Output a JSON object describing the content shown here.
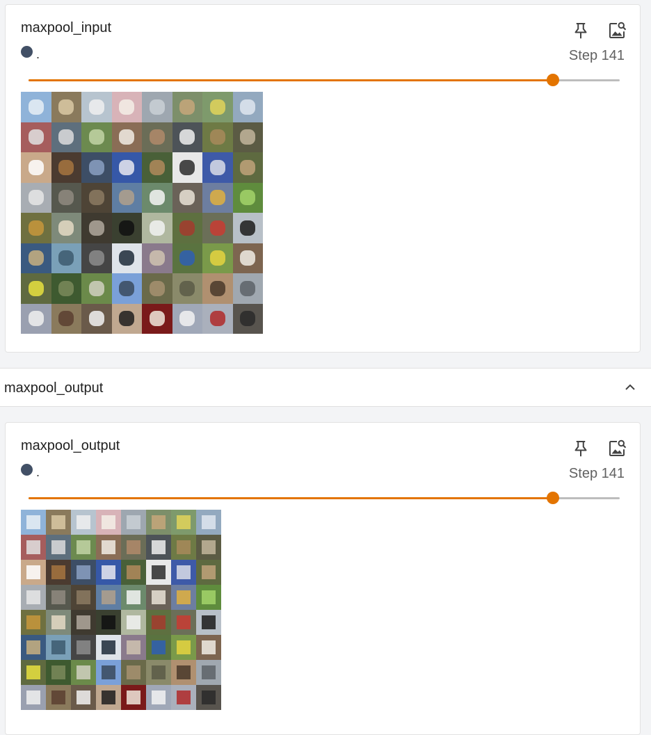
{
  "accent_color": "#e37400",
  "run_color": "#425066",
  "cards": [
    {
      "title": "maxpool_input",
      "run_name": ".",
      "step_label": "Step 141",
      "slider_value_fraction": 0.887,
      "pin_icon": "pin-icon",
      "image_icon": "image-search-icon"
    },
    {
      "title": "maxpool_output",
      "run_name": ".",
      "step_label": "Step 141",
      "slider_value_fraction": 0.887,
      "pin_icon": "pin-icon",
      "image_icon": "image-search-icon"
    }
  ],
  "section": {
    "title": "maxpool_output",
    "toggle_icon": "chevron-up-icon"
  },
  "image_grid": {
    "rows": 8,
    "cols": 8,
    "tiles": [
      [
        "#8fb3d9",
        "#e8eef5"
      ],
      [
        "#8a7a5c",
        "#d9c9a3"
      ],
      [
        "#b7c4cf",
        "#f0f0f0"
      ],
      [
        "#d8b3b8",
        "#f5efe6"
      ],
      [
        "#9ea7b0",
        "#c9d0d6"
      ],
      [
        "#7d8f6a",
        "#c6a77a"
      ],
      [
        "#7e9a6c",
        "#e0d35a"
      ],
      [
        "#93a9bf",
        "#dfe6ee"
      ],
      [
        "#a65d5d",
        "#e0e0e0"
      ],
      [
        "#5e6f7d",
        "#dcdcdc"
      ],
      [
        "#6c8a4f",
        "#c2d4a4"
      ],
      [
        "#8a6d56",
        "#f1ece4"
      ],
      [
        "#6b6d57",
        "#b08a6a"
      ],
      [
        "#4d5358",
        "#eeeeee"
      ],
      [
        "#6e7a45",
        "#a88a5a"
      ],
      [
        "#5b5b44",
        "#c2b59b"
      ],
      [
        "#c9a98a",
        "#ffffff"
      ],
      [
        "#4b3b30",
        "#a6763f"
      ],
      [
        "#3d4e66",
        "#8aa0c2"
      ],
      [
        "#3658a8",
        "#e8e8f0"
      ],
      [
        "#496038",
        "#b08a5c"
      ],
      [
        "#e8e8e8",
        "#2c2c2c"
      ],
      [
        "#3e5aa8",
        "#d9dde8"
      ],
      [
        "#5e6a40",
        "#c0a27a"
      ],
      [
        "#a8adb3",
        "#e6e6e6"
      ],
      [
        "#56584e",
        "#8f8a80"
      ],
      [
        "#4e4436",
        "#8c7a62"
      ],
      [
        "#5f7ea3",
        "#b0a08c"
      ],
      [
        "#6c8a6c",
        "#f5f5f5"
      ],
      [
        "#6a6258",
        "#e9e3d6"
      ],
      [
        "#6d7ea0",
        "#e0b040"
      ],
      [
        "#5f8c3d",
        "#a3d36a"
      ],
      [
        "#6f7040",
        "#c8963c"
      ],
      [
        "#7e8a7a",
        "#e4d9c4"
      ],
      [
        "#3f3a30",
        "#b0a89c"
      ],
      [
        "#3a4030",
        "#101010"
      ],
      [
        "#b0b8a0",
        "#f2f2f2"
      ],
      [
        "#5e7040",
        "#a33b2e"
      ],
      [
        "#6b6f58",
        "#c83c32"
      ],
      [
        "#b8c0c8",
        "#1c1c1c"
      ],
      [
        "#3a5a80",
        "#c8b080"
      ],
      [
        "#7aa0b8",
        "#3d5a6e"
      ],
      [
        "#454545",
        "#8c8c8c"
      ],
      [
        "#dfe4ea",
        "#1f2b3a"
      ],
      [
        "#8a7a8c",
        "#cfc3b0"
      ],
      [
        "#5a7340",
        "#2f5fb3"
      ],
      [
        "#7a9a4a",
        "#e5d340"
      ],
      [
        "#7d6550",
        "#f0ece4"
      ],
      [
        "#5f6a40",
        "#e8e040"
      ],
      [
        "#3e5a30",
        "#7a8a5a"
      ],
      [
        "#6b8a4a",
        "#d0d0c0"
      ],
      [
        "#7aa0d8",
        "#3a4a5e"
      ],
      [
        "#6a6a4a",
        "#a69070"
      ],
      [
        "#8a8a6a",
        "#5a5a46"
      ],
      [
        "#b09070",
        "#4a3a2a"
      ],
      [
        "#a0a8b0",
        "#5d6368"
      ],
      [
        "#9aa0b0",
        "#f0f0f0"
      ],
      [
        "#8a7a5c",
        "#5b4030"
      ],
      [
        "#6a5a4a",
        "#f2f2f2"
      ],
      [
        "#c0a890",
        "#1e1e1e"
      ],
      [
        "#7a1a1a",
        "#f0e8dc"
      ],
      [
        "#a0a8b8",
        "#f2f2f2"
      ],
      [
        "#aab0bc",
        "#b02a2a"
      ],
      [
        "#58544e",
        "#2a2a2a"
      ]
    ]
  }
}
